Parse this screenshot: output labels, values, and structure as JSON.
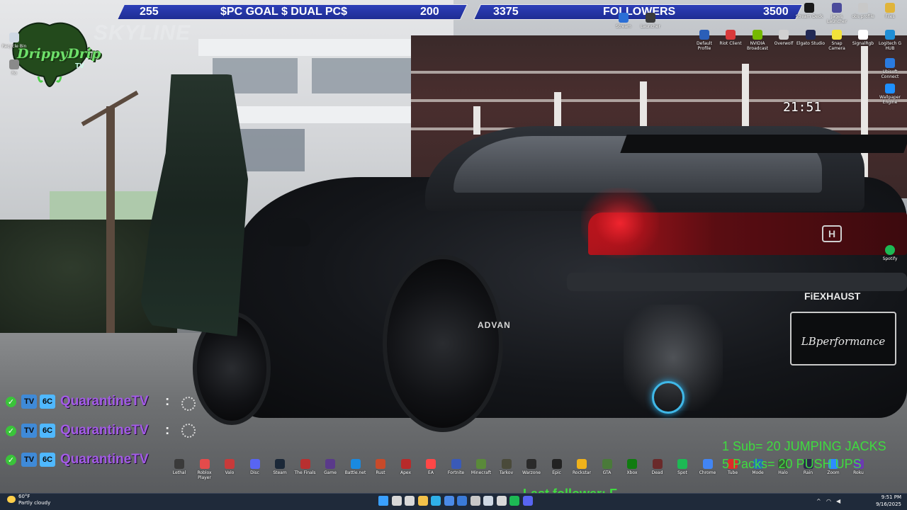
{
  "goal_left": {
    "current": "255",
    "title": "$PC GOAL $ DUAL PC$",
    "target": "200"
  },
  "goal_right": {
    "current": "3375",
    "title": "FOLLOWERS",
    "target": "3500"
  },
  "logo": {
    "name": "DrippyDrip",
    "sub": "TV"
  },
  "wallpaper_text": {
    "skyline": "SKYLINE",
    "exhaust": "FiEXHAUST",
    "advan": "ADVAN",
    "plate": "LBperformance",
    "badge": "H"
  },
  "clock": "21:51",
  "desktop_icons_top": [
    {
      "label": "Stream",
      "color": "#2b6fd6"
    },
    {
      "label": "Launcher",
      "color": "#3b3b3b"
    },
    {
      "label": "Stream Deck",
      "color": "#1a1a1a"
    },
    {
      "label": "Jages Launcher",
      "color": "#4b4b9b"
    },
    {
      "label": "obs profile",
      "color": "#c8c8c8"
    },
    {
      "label": "Files",
      "color": "#e0b43a"
    }
  ],
  "desktop_icons_row2": [
    {
      "label": "Default Profile",
      "color": "#2b5fb8"
    },
    {
      "label": "Riot Client",
      "color": "#d93a3a"
    },
    {
      "label": "NVIDIA Broadcast",
      "color": "#76b900"
    },
    {
      "label": "Overwolf",
      "color": "#d0d0d0"
    },
    {
      "label": "Elgato Studio",
      "color": "#222a55"
    },
    {
      "label": "Snap Camera",
      "color": "#f2e23a"
    },
    {
      "label": "SignalRgb",
      "color": "#ffffff"
    },
    {
      "label": "Logitech G HUB",
      "color": "#1f8fd6"
    }
  ],
  "desktop_icons_right": [
    {
      "label": "Ubisoft Connect",
      "color": "#2a7be0"
    },
    {
      "label": "Wallpaper Engine",
      "color": "#1e90ff"
    },
    {
      "label": "Spotify",
      "color": "#1db954"
    }
  ],
  "desktop_icons_left": [
    {
      "label": "Recycle Bin",
      "color": "#cfd8e3"
    },
    {
      "label": "Ro",
      "color": "#8a8a8a"
    }
  ],
  "desktop_icons_bottom": [
    {
      "label": "Lethal",
      "color": "#3a3a3a"
    },
    {
      "label": "Roblox Player",
      "color": "#e34b4b"
    },
    {
      "label": "Valo",
      "color": "#c83a3a"
    },
    {
      "label": "Disc",
      "color": "#5865f2"
    },
    {
      "label": "Steam",
      "color": "#1b2838"
    },
    {
      "label": "The Finals",
      "color": "#b83030"
    },
    {
      "label": "Game",
      "color": "#5a3a8a"
    },
    {
      "label": "Battle.net",
      "color": "#1a8ae0"
    },
    {
      "label": "Rust",
      "color": "#c84a2a"
    },
    {
      "label": "Apex",
      "color": "#b82a2a"
    },
    {
      "label": "EA",
      "color": "#ff4747"
    },
    {
      "label": "Fortnite",
      "color": "#3a5ab8"
    },
    {
      "label": "Minecraft",
      "color": "#5a8a3a"
    },
    {
      "label": "Tarkov",
      "color": "#4a4a3a"
    },
    {
      "label": "Warzone",
      "color": "#2a2a2a"
    },
    {
      "label": "Epic",
      "color": "#222222"
    },
    {
      "label": "Rockstar",
      "color": "#f0b21a"
    },
    {
      "label": "GTA",
      "color": "#4a7a3a"
    },
    {
      "label": "Xbox",
      "color": "#107c10"
    },
    {
      "label": "Dead",
      "color": "#6a2a2a"
    },
    {
      "label": "Spot",
      "color": "#1db954"
    },
    {
      "label": "Chrome",
      "color": "#4285f4"
    },
    {
      "label": "Tube",
      "color": "#e02a2a"
    },
    {
      "label": "Mode",
      "color": "#2a6ab8"
    },
    {
      "label": "Halo",
      "color": "#3a5a3a"
    },
    {
      "label": "Rain",
      "color": "#2a2a4a"
    },
    {
      "label": "Zoom",
      "color": "#2d8cff"
    },
    {
      "label": "Roku",
      "color": "#6c3bb0"
    }
  ],
  "chat": [
    {
      "name": "QuarantineTV",
      "badge1": "TV",
      "badge2": "6C"
    },
    {
      "name": "QuarantineTV",
      "badge1": "TV",
      "badge2": "6C"
    },
    {
      "name": "QuarantineTV",
      "badge1": "TV",
      "badge2": "6C"
    }
  ],
  "overlay_lines": [
    "1 Sub= 20 JUMPING JACKS",
    "5 Packs= 20 PUSH UPS"
  ],
  "last_follower": "Last follower: F",
  "taskbar": {
    "weather_temp": "60°F",
    "weather_desc": "Partly cloudy",
    "time": "9:51 PM",
    "date": "9/16/2025",
    "apps": [
      {
        "name": "start-icon",
        "color": "#3aa0ff"
      },
      {
        "name": "search-icon",
        "color": "#d8d8d8"
      },
      {
        "name": "task-view-icon",
        "color": "#d8d8d8"
      },
      {
        "name": "file-explorer-icon",
        "color": "#f2c14a"
      },
      {
        "name": "edge-icon",
        "color": "#2fb0e8"
      },
      {
        "name": "store-icon",
        "color": "#4a8ae8"
      },
      {
        "name": "mail-icon",
        "color": "#3a7ad8"
      },
      {
        "name": "settings-icon",
        "color": "#c8c8c8"
      },
      {
        "name": "steam-icon",
        "color": "#cfd8e3"
      },
      {
        "name": "obs-icon",
        "color": "#d8d8d8"
      },
      {
        "name": "spotify-icon",
        "color": "#1db954"
      },
      {
        "name": "discord-icon",
        "color": "#5865f2"
      }
    ]
  }
}
